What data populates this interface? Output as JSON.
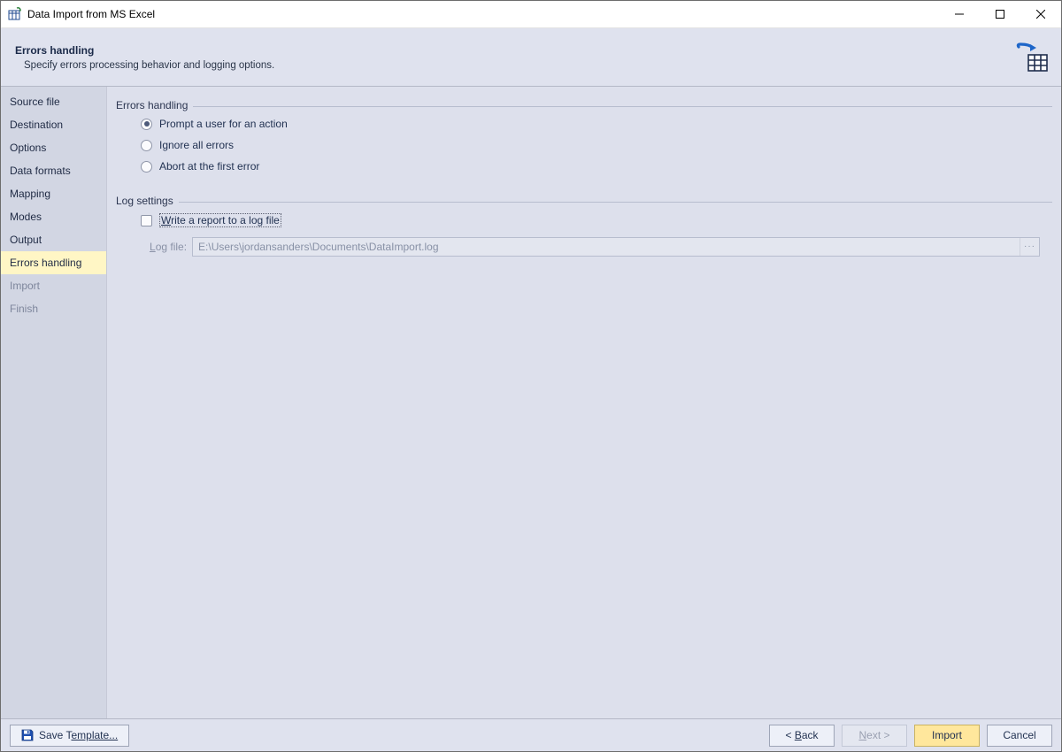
{
  "window": {
    "title": "Data Import from MS Excel"
  },
  "instr": {
    "title": "Errors handling",
    "subtitle": "Specify errors processing behavior and logging options."
  },
  "sidebar": {
    "items": [
      {
        "label": "Source file",
        "state": "normal"
      },
      {
        "label": "Destination",
        "state": "normal"
      },
      {
        "label": "Options",
        "state": "normal"
      },
      {
        "label": "Data formats",
        "state": "normal"
      },
      {
        "label": "Mapping",
        "state": "normal"
      },
      {
        "label": "Modes",
        "state": "normal"
      },
      {
        "label": "Output",
        "state": "normal"
      },
      {
        "label": "Errors handling",
        "state": "selected"
      },
      {
        "label": "Import",
        "state": "disabled"
      },
      {
        "label": "Finish",
        "state": "disabled"
      }
    ]
  },
  "groups": {
    "errors": {
      "legend": "Errors handling",
      "options": [
        "Prompt a user for an action",
        "Ignore all errors",
        "Abort at the first error"
      ],
      "selected_index": 0
    },
    "log": {
      "legend": "Log settings",
      "checkbox_pre": "W",
      "checkbox_post": "rite a report to a log file",
      "checked": false,
      "logfile_pre": "L",
      "logfile_post": "og file:",
      "logfile_value": "E:\\Users\\jordansanders\\Documents\\DataImport.log",
      "browse": "···"
    }
  },
  "footer": {
    "save_template": "emplate...",
    "save_template_pre": "Save T",
    "back_pre": "< ",
    "back_accel": "B",
    "back_post": "ack",
    "next_pre": "",
    "next_accel": "N",
    "next_post": "ext >",
    "import": "Import",
    "cancel": "Cancel"
  }
}
